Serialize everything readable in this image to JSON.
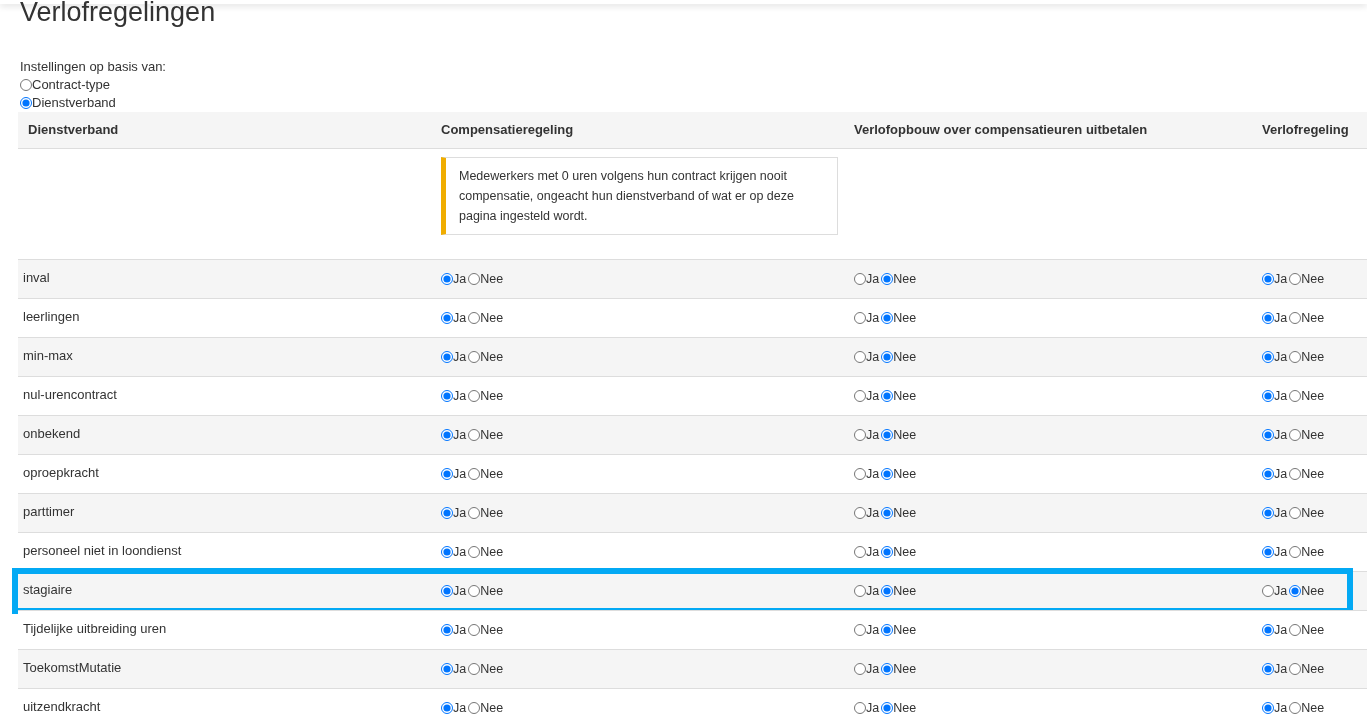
{
  "title": "Verlofregelingen",
  "basis": {
    "label": "Instellingen op basis van:",
    "options": [
      {
        "label": "Contract-type",
        "selected": false
      },
      {
        "label": "Dienstverband",
        "selected": true
      }
    ]
  },
  "table": {
    "columns": [
      "Dienstverband",
      "Compensatieregeling",
      "Verlofopbouw over compensatieuren uitbetalen",
      "Verlofregeling"
    ],
    "notice": "Medewerkers met 0 uren volgens hun contract krijgen nooit compensatie, ongeacht hun dienstverband of wat er op deze pagina ingesteld wordt.",
    "rows": [
      {
        "name": "inval",
        "highlighted": false,
        "settings": [
          [
            {
              "label": "Ja",
              "selected": true
            },
            {
              "label": "Nee",
              "selected": false
            }
          ],
          [
            {
              "label": "Ja",
              "selected": false
            },
            {
              "label": "Nee",
              "selected": true
            }
          ],
          [
            {
              "label": "Ja",
              "selected": true
            },
            {
              "label": "Nee",
              "selected": false
            }
          ]
        ]
      },
      {
        "name": "leerlingen",
        "highlighted": false,
        "settings": [
          [
            {
              "label": "Ja",
              "selected": true
            },
            {
              "label": "Nee",
              "selected": false
            }
          ],
          [
            {
              "label": "Ja",
              "selected": false
            },
            {
              "label": "Nee",
              "selected": true
            }
          ],
          [
            {
              "label": "Ja",
              "selected": true
            },
            {
              "label": "Nee",
              "selected": false
            }
          ]
        ]
      },
      {
        "name": "min-max",
        "highlighted": false,
        "settings": [
          [
            {
              "label": "Ja",
              "selected": true
            },
            {
              "label": "Nee",
              "selected": false
            }
          ],
          [
            {
              "label": "Ja",
              "selected": false
            },
            {
              "label": "Nee",
              "selected": true
            }
          ],
          [
            {
              "label": "Ja",
              "selected": true
            },
            {
              "label": "Nee",
              "selected": false
            }
          ]
        ]
      },
      {
        "name": "nul-urencontract",
        "highlighted": false,
        "settings": [
          [
            {
              "label": "Ja",
              "selected": true
            },
            {
              "label": "Nee",
              "selected": false
            }
          ],
          [
            {
              "label": "Ja",
              "selected": false
            },
            {
              "label": "Nee",
              "selected": true
            }
          ],
          [
            {
              "label": "Ja",
              "selected": true
            },
            {
              "label": "Nee",
              "selected": false
            }
          ]
        ]
      },
      {
        "name": "onbekend",
        "highlighted": false,
        "settings": [
          [
            {
              "label": "Ja",
              "selected": true
            },
            {
              "label": "Nee",
              "selected": false
            }
          ],
          [
            {
              "label": "Ja",
              "selected": false
            },
            {
              "label": "Nee",
              "selected": true
            }
          ],
          [
            {
              "label": "Ja",
              "selected": true
            },
            {
              "label": "Nee",
              "selected": false
            }
          ]
        ]
      },
      {
        "name": "oproepkracht",
        "highlighted": false,
        "settings": [
          [
            {
              "label": "Ja",
              "selected": true
            },
            {
              "label": "Nee",
              "selected": false
            }
          ],
          [
            {
              "label": "Ja",
              "selected": false
            },
            {
              "label": "Nee",
              "selected": true
            }
          ],
          [
            {
              "label": "Ja",
              "selected": true
            },
            {
              "label": "Nee",
              "selected": false
            }
          ]
        ]
      },
      {
        "name": "parttimer",
        "highlighted": false,
        "settings": [
          [
            {
              "label": "Ja",
              "selected": true
            },
            {
              "label": "Nee",
              "selected": false
            }
          ],
          [
            {
              "label": "Ja",
              "selected": false
            },
            {
              "label": "Nee",
              "selected": true
            }
          ],
          [
            {
              "label": "Ja",
              "selected": true
            },
            {
              "label": "Nee",
              "selected": false
            }
          ]
        ]
      },
      {
        "name": "personeel niet in loondienst",
        "highlighted": false,
        "settings": [
          [
            {
              "label": "Ja",
              "selected": true
            },
            {
              "label": "Nee",
              "selected": false
            }
          ],
          [
            {
              "label": "Ja",
              "selected": false
            },
            {
              "label": "Nee",
              "selected": true
            }
          ],
          [
            {
              "label": "Ja",
              "selected": true
            },
            {
              "label": "Nee",
              "selected": false
            }
          ]
        ]
      },
      {
        "name": "stagiaire",
        "highlighted": true,
        "settings": [
          [
            {
              "label": "Ja",
              "selected": true
            },
            {
              "label": "Nee",
              "selected": false
            }
          ],
          [
            {
              "label": "Ja",
              "selected": false
            },
            {
              "label": "Nee",
              "selected": true
            }
          ],
          [
            {
              "label": "Ja",
              "selected": false
            },
            {
              "label": "Nee",
              "selected": true
            }
          ]
        ]
      },
      {
        "name": "Tijdelijke uitbreiding uren",
        "highlighted": false,
        "settings": [
          [
            {
              "label": "Ja",
              "selected": true
            },
            {
              "label": "Nee",
              "selected": false
            }
          ],
          [
            {
              "label": "Ja",
              "selected": false
            },
            {
              "label": "Nee",
              "selected": true
            }
          ],
          [
            {
              "label": "Ja",
              "selected": true
            },
            {
              "label": "Nee",
              "selected": false
            }
          ]
        ]
      },
      {
        "name": "ToekomstMutatie",
        "highlighted": false,
        "settings": [
          [
            {
              "label": "Ja",
              "selected": true
            },
            {
              "label": "Nee",
              "selected": false
            }
          ],
          [
            {
              "label": "Ja",
              "selected": false
            },
            {
              "label": "Nee",
              "selected": true
            }
          ],
          [
            {
              "label": "Ja",
              "selected": true
            },
            {
              "label": "Nee",
              "selected": false
            }
          ]
        ]
      },
      {
        "name": "uitzendkracht",
        "highlighted": false,
        "settings": [
          [
            {
              "label": "Ja",
              "selected": true
            },
            {
              "label": "Nee",
              "selected": false
            }
          ],
          [
            {
              "label": "Ja",
              "selected": false
            },
            {
              "label": "Nee",
              "selected": true
            }
          ],
          [
            {
              "label": "Ja",
              "selected": true
            },
            {
              "label": "Nee",
              "selected": false
            }
          ]
        ]
      }
    ]
  }
}
